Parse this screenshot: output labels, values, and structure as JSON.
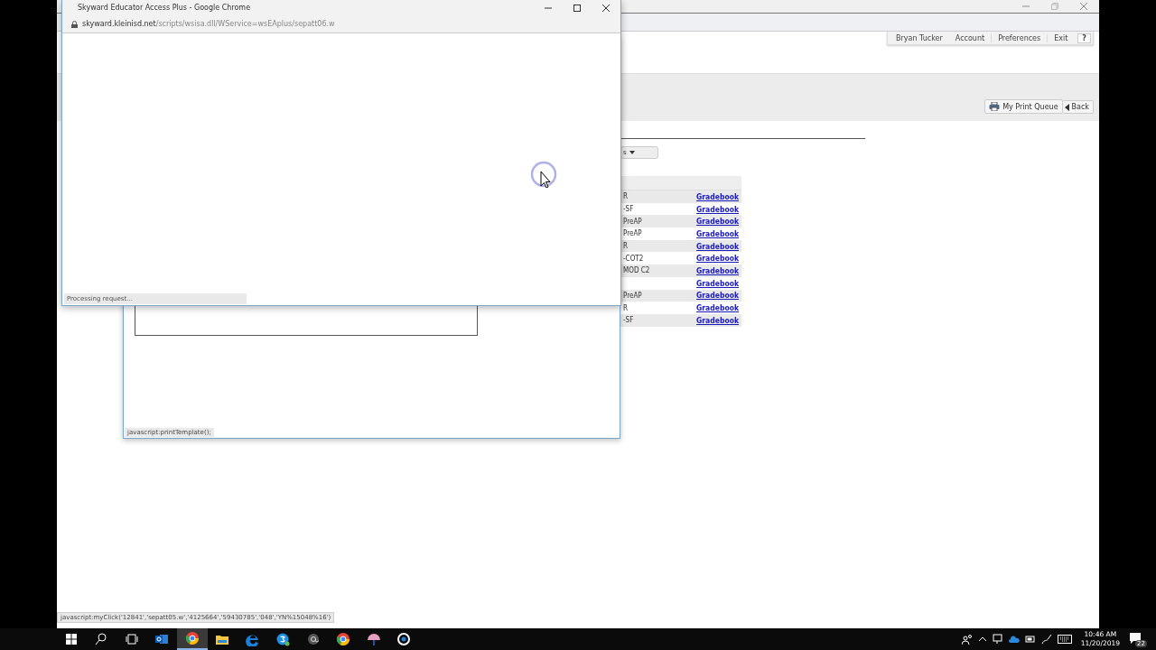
{
  "back_window": {
    "user_menu": [
      "Bryan Tucker",
      "Account",
      "Preferences",
      "Exit",
      "?"
    ],
    "toolbar": [
      "My Print Queue",
      "Back"
    ],
    "dropdown_label": "s",
    "rows": [
      {
        "course": "R",
        "link": "Gradebook"
      },
      {
        "course": "-SF",
        "link": "Gradebook"
      },
      {
        "course": "PreAP",
        "link": "Gradebook"
      },
      {
        "course": "PreAP",
        "link": "Gradebook"
      },
      {
        "course": "R",
        "link": "Gradebook"
      },
      {
        "course": "-COT2",
        "link": "Gradebook"
      },
      {
        "course": "MOD C2",
        "link": "Gradebook"
      },
      {
        "link": "Gradebook"
      },
      {
        "course": "PreAP",
        "link": "Gradebook"
      },
      {
        "course": "R",
        "link": "Gradebook"
      },
      {
        "course": "-SF",
        "link": "Gradebook"
      }
    ],
    "status": "javascript:myClick('12841','sepatt05.w','4125664','59430785','048','YN%15048%16')"
  },
  "popup_window": {
    "status": "javascript:printTemplate();"
  },
  "front_window": {
    "title": "Skyward Educator Access Plus - Google Chrome",
    "url_host": "skyward.kleinisd.net",
    "url_path": "/scripts/wsisa.dll/WService=wsEAplus/sepatt06.w",
    "status": "Processing request..."
  },
  "taskbar": {
    "apps": [
      {
        "kind": "start",
        "selected": false
      },
      {
        "kind": "search",
        "selected": false
      },
      {
        "kind": "taskview",
        "selected": false
      },
      {
        "kind": "mail",
        "selected": false
      },
      {
        "kind": "browser",
        "selected": true
      },
      {
        "kind": "folder",
        "selected": false
      },
      {
        "kind": "edge",
        "selected": false
      },
      {
        "kind": "chat",
        "selected": false
      },
      {
        "kind": "at",
        "selected": false
      },
      {
        "kind": "browser",
        "selected": false
      },
      {
        "kind": "paint",
        "selected": false
      },
      {
        "kind": "ring",
        "selected": false
      }
    ],
    "time": "10:46 AM",
    "date": "11/20/2019",
    "notifications": "22"
  }
}
